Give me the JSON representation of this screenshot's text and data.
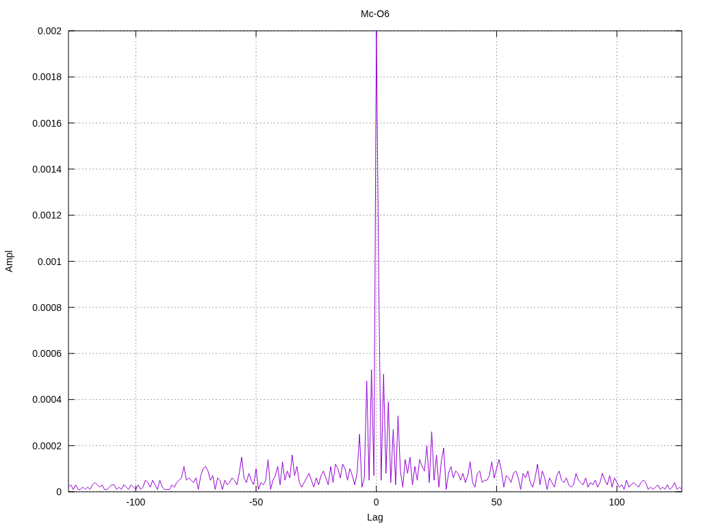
{
  "chart_data": {
    "type": "line",
    "grid": true,
    "title": "Mc-O6",
    "xlabel": "Lag",
    "ylabel": "Ampl",
    "xlim": [
      -128,
      127
    ],
    "ylim": [
      0,
      0.002
    ],
    "xticks": [
      -100,
      -50,
      0,
      50,
      100
    ],
    "yticks": [
      0,
      0.0002,
      0.0004,
      0.0006,
      0.0008,
      0.001,
      0.0012,
      0.0014,
      0.0016,
      0.0018,
      0.002
    ],
    "x": [
      -128,
      -127,
      -126,
      -125,
      -124,
      -123,
      -122,
      -121,
      -120,
      -119,
      -118,
      -117,
      -116,
      -115,
      -114,
      -113,
      -112,
      -111,
      -110,
      -109,
      -108,
      -107,
      -106,
      -105,
      -104,
      -103,
      -102,
      -101,
      -100,
      -99,
      -98,
      -97,
      -96,
      -95,
      -94,
      -93,
      -92,
      -91,
      -90,
      -89,
      -88,
      -87,
      -86,
      -85,
      -84,
      -83,
      -82,
      -81,
      -80,
      -79,
      -78,
      -77,
      -76,
      -75,
      -74,
      -73,
      -72,
      -71,
      -70,
      -69,
      -68,
      -67,
      -66,
      -65,
      -64,
      -63,
      -62,
      -61,
      -60,
      -59,
      -58,
      -57,
      -56,
      -55,
      -54,
      -53,
      -52,
      -51,
      -50,
      -49,
      -48,
      -47,
      -46,
      -45,
      -44,
      -43,
      -42,
      -41,
      -40,
      -39,
      -38,
      -37,
      -36,
      -35,
      -34,
      -33,
      -32,
      -31,
      -30,
      -29,
      -28,
      -27,
      -26,
      -25,
      -24,
      -23,
      -22,
      -21,
      -20,
      -19,
      -18,
      -17,
      -16,
      -15,
      -14,
      -13,
      -12,
      -11,
      -10,
      -9,
      -8,
      -7,
      -6,
      -5,
      -4,
      -3,
      -2,
      -1,
      0,
      1,
      2,
      3,
      4,
      5,
      6,
      7,
      8,
      9,
      10,
      11,
      12,
      13,
      14,
      15,
      16,
      17,
      18,
      19,
      20,
      21,
      22,
      23,
      24,
      25,
      26,
      27,
      28,
      29,
      30,
      31,
      32,
      33,
      34,
      35,
      36,
      37,
      38,
      39,
      40,
      41,
      42,
      43,
      44,
      45,
      46,
      47,
      48,
      49,
      50,
      51,
      52,
      53,
      54,
      55,
      56,
      57,
      58,
      59,
      60,
      61,
      62,
      63,
      64,
      65,
      66,
      67,
      68,
      69,
      70,
      71,
      72,
      73,
      74,
      75,
      76,
      77,
      78,
      79,
      80,
      81,
      82,
      83,
      84,
      85,
      86,
      87,
      88,
      89,
      90,
      91,
      92,
      93,
      94,
      95,
      96,
      97,
      98,
      99,
      100,
      101,
      102,
      103,
      104,
      105,
      106,
      107,
      108,
      109,
      110,
      111,
      112,
      113,
      114,
      115,
      116,
      117,
      118,
      119,
      120,
      121,
      122,
      123,
      124,
      125,
      126,
      127
    ],
    "series": [
      {
        "color": "#9400d3",
        "values": [
          2e-05,
          3e-05,
          1e-05,
          3e-05,
          1e-05,
          1e-05,
          2e-05,
          1e-05,
          2e-05,
          1e-05,
          3e-05,
          4e-05,
          3e-05,
          2e-05,
          3e-05,
          1e-05,
          1e-05,
          2e-05,
          3e-05,
          3e-05,
          1e-05,
          2e-05,
          1e-05,
          3e-05,
          2e-05,
          1e-05,
          3e-05,
          2e-05,
          1e-05,
          3e-05,
          1e-05,
          2e-05,
          5e-05,
          4e-05,
          2e-05,
          5e-05,
          3e-05,
          1e-05,
          5e-05,
          2e-05,
          1e-05,
          1e-05,
          1e-05,
          3e-05,
          2e-05,
          4e-05,
          5e-05,
          6e-05,
          0.00011,
          5e-05,
          6e-05,
          5e-05,
          4e-05,
          6e-05,
          1e-05,
          7e-05,
          0.0001,
          0.00011,
          9e-05,
          5e-05,
          7e-05,
          1e-05,
          6e-05,
          5e-05,
          1e-05,
          5e-05,
          3e-05,
          4e-05,
          6e-05,
          5e-05,
          3e-05,
          8e-05,
          0.00015,
          6e-05,
          4e-05,
          8e-05,
          5e-05,
          3e-05,
          0.0001,
          1e-05,
          4e-05,
          3e-05,
          5e-05,
          0.00014,
          1e-05,
          5e-05,
          7e-05,
          0.00011,
          3e-05,
          0.00013,
          5e-05,
          9e-05,
          6e-05,
          0.00016,
          7e-05,
          0.00011,
          4e-05,
          2e-05,
          4e-05,
          6e-05,
          8e-05,
          5e-05,
          2e-05,
          6e-05,
          3e-05,
          7e-05,
          9e-05,
          6e-05,
          3e-05,
          0.00011,
          4e-05,
          0.00012,
          0.0001,
          6e-05,
          0.00012,
          0.0001,
          5e-05,
          0.0001,
          7e-05,
          3e-05,
          8e-05,
          0.00025,
          2e-05,
          6e-05,
          0.00048,
          5e-05,
          0.00053,
          7e-05,
          0.002,
          0.0009,
          5e-05,
          0.00051,
          8e-05,
          0.00039,
          4e-05,
          0.00027,
          3e-05,
          0.00033,
          9e-05,
          2e-05,
          0.00014,
          8e-05,
          0.00015,
          3e-05,
          0.00011,
          5e-05,
          0.00014,
          0.00011,
          9e-05,
          0.0002,
          4e-05,
          0.00026,
          5e-05,
          0.00016,
          2e-05,
          0.00013,
          0.00019,
          1e-05,
          8e-05,
          0.00011,
          6e-05,
          9e-05,
          8e-05,
          5e-05,
          8e-05,
          4e-05,
          7e-05,
          0.00013,
          4e-05,
          2e-05,
          8e-05,
          9e-05,
          4e-05,
          5e-05,
          5e-05,
          7e-05,
          0.00013,
          6e-05,
          0.0001,
          0.00014,
          9e-05,
          2e-05,
          7e-05,
          6e-05,
          4e-05,
          8e-05,
          9e-05,
          6e-05,
          1e-05,
          8e-05,
          6e-05,
          9e-05,
          4e-05,
          2e-05,
          6e-05,
          0.00012,
          3e-05,
          9e-05,
          6e-05,
          1e-05,
          6e-05,
          4e-05,
          2e-05,
          7e-05,
          9e-05,
          5e-05,
          4e-05,
          6e-05,
          3e-05,
          2e-05,
          3e-05,
          8e-05,
          5e-05,
          4e-05,
          3e-05,
          6e-05,
          2e-05,
          4e-05,
          3e-05,
          5e-05,
          2e-05,
          4e-05,
          8e-05,
          5e-05,
          3e-05,
          7e-05,
          2e-05,
          6e-05,
          4e-05,
          2e-05,
          3e-05,
          1e-05,
          5e-05,
          2e-05,
          3e-05,
          4e-05,
          3e-05,
          2e-05,
          4e-05,
          5e-05,
          4e-05,
          1e-05,
          2e-05,
          1e-05,
          2e-05,
          3e-05,
          1e-05,
          2e-05,
          1e-05,
          3e-05,
          1e-05,
          2e-05,
          4e-05,
          1e-05,
          2e-05,
          1e-05
        ]
      }
    ]
  }
}
